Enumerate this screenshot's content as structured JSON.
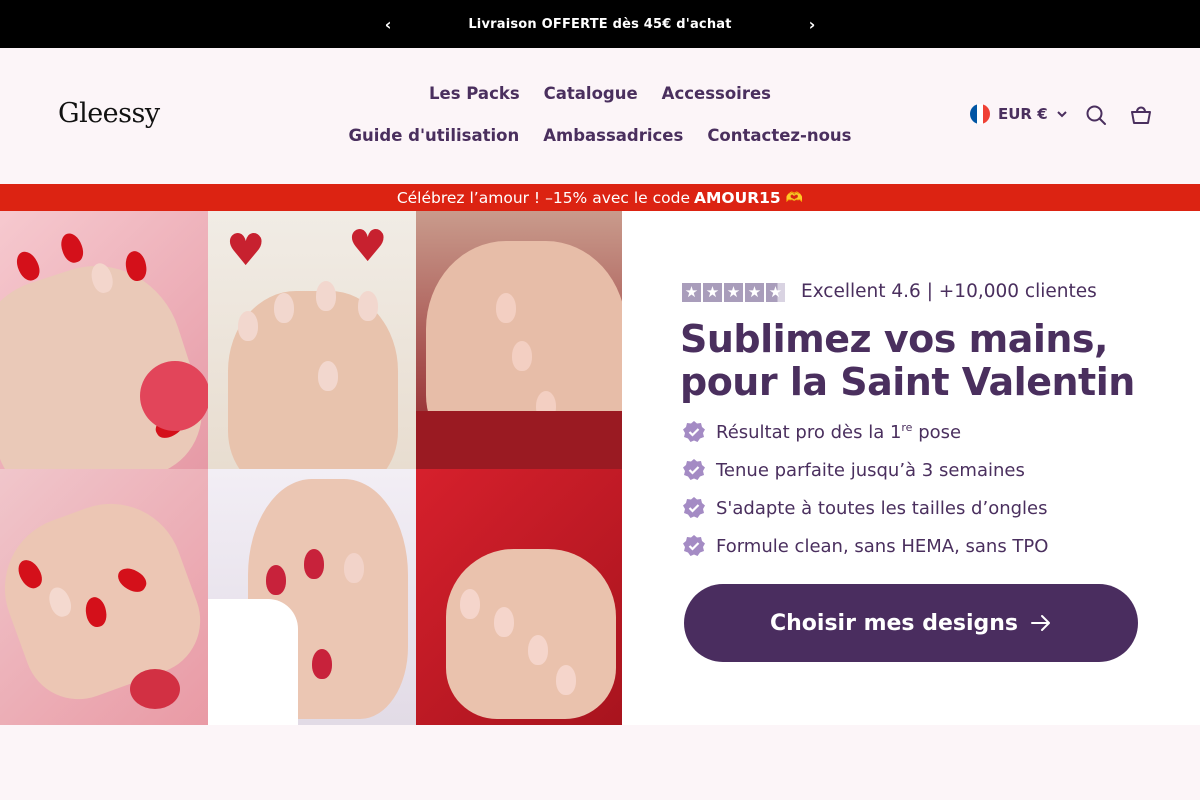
{
  "announcement": {
    "prev_icon": "chevron-left-icon",
    "message": "Livraison OFFERTE dès 45€ d'achat",
    "next_icon": "chevron-right-icon"
  },
  "header": {
    "logo": "Gleessy",
    "nav": [
      "Les Packs",
      "Catalogue",
      "Accessoires",
      "Guide d'utilisation",
      "Ambassadrices",
      "Contactez-nous"
    ],
    "currency": "EUR €",
    "flag": "france-flag-icon",
    "search_icon": "search-icon",
    "cart_icon": "cart-icon"
  },
  "promo": {
    "text": "Célébrez l’amour !  –15% avec le code",
    "code": "AMOUR15",
    "emoji": "🫶"
  },
  "hero": {
    "rating": "Excellent 4.6 | +10,000 clientes",
    "stars": 5,
    "title": "Sublimez vos mains, pour la Saint Valentin",
    "benefits": [
      "Résultat pro dès la 1re pose",
      "Tenue parfaite jusqu’à 3 semaines",
      "S'adapte à toutes les tailles d’ongles",
      "Formule clean, sans HEMA, sans TPO"
    ],
    "cta": "Choisir mes designs"
  },
  "colors": {
    "announcement_bg": "#000000",
    "promo_bg": "#dc2312",
    "brand_purple": "#4a2d5f",
    "check_bg": "#a48bc4",
    "page_bg": "#fcf5f8"
  }
}
